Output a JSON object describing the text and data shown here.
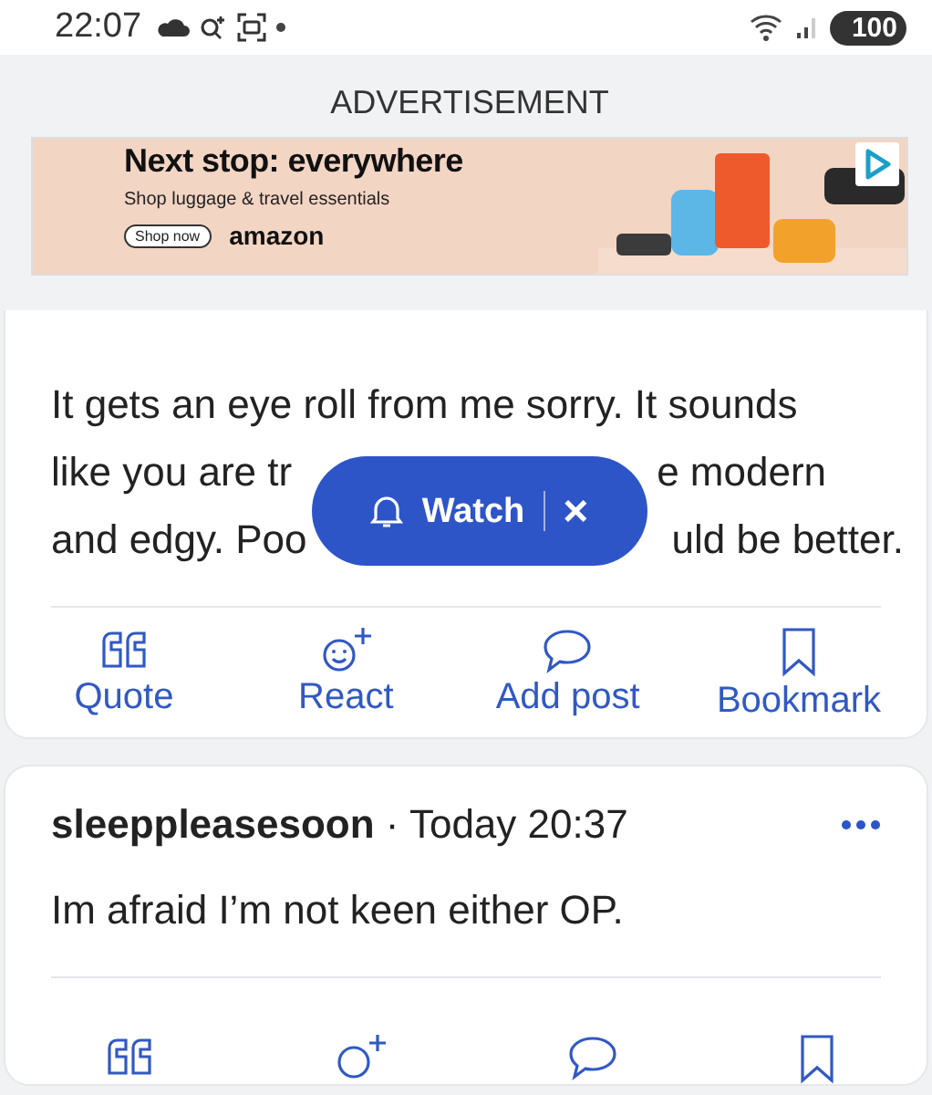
{
  "status_bar": {
    "time": "22:07",
    "battery": "100"
  },
  "ad": {
    "label": "ADVERTISEMENT",
    "headline": "Next stop: everywhere",
    "subline": "Shop luggage & travel essentials",
    "button": "Shop now",
    "brand": "amazon"
  },
  "posts": [
    {
      "lines": [
        [
          "It gets an eye roll from me sorry. It sounds"
        ],
        [
          "like you are tr",
          "e modern"
        ],
        [
          "and edgy. Poo",
          "uld be better."
        ]
      ],
      "actions": [
        "Quote",
        "React",
        "Add post",
        "Bookmark"
      ]
    },
    {
      "author": "sleeppleasesoon",
      "time": "· Today 20:37",
      "lines": [
        [
          "Im afraid I’m not keen either OP."
        ]
      ]
    }
  ],
  "watch": {
    "label": "Watch",
    "close": "×"
  }
}
